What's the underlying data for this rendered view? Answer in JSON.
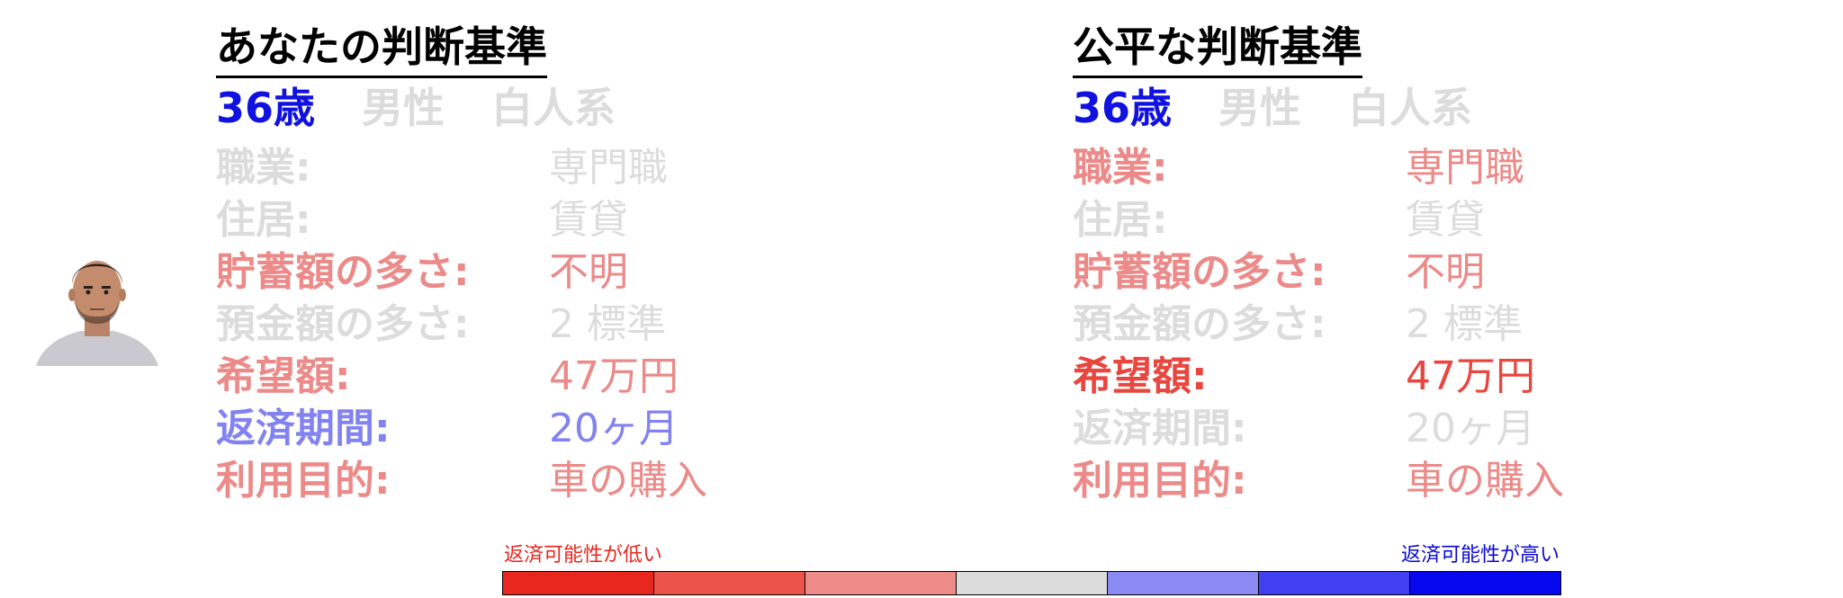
{
  "colors": {
    "gray": "#dcdcdc",
    "pink": "#eb8a88",
    "red": "#e8463f",
    "blue": "#1111e0",
    "periwinkle": "#8282f0"
  },
  "panels": [
    {
      "title": "あなたの判断基準",
      "demographics": [
        {
          "text": "36歳",
          "color": "#1111e0"
        },
        {
          "text": "男性",
          "color": "#dcdcdc"
        },
        {
          "text": "白人系",
          "color": "#dcdcdc"
        }
      ],
      "rows": [
        {
          "label": "職業:",
          "value": "専門職",
          "color": "#dcdcdc"
        },
        {
          "label": "住居:",
          "value": "賃貸",
          "color": "#dcdcdc"
        },
        {
          "label": "貯蓄額の多さ:",
          "value": "不明",
          "color": "#eb8a88"
        },
        {
          "label": "預金額の多さ:",
          "value": "2 標準",
          "color": "#dcdcdc"
        },
        {
          "label": "希望額:",
          "value": "47万円",
          "color": "#eb8a88"
        },
        {
          "label": "返済期間:",
          "value": "20ヶ月",
          "color": "#8282f0"
        },
        {
          "label": "利用目的:",
          "value": "車の購入",
          "color": "#eb8a88"
        }
      ]
    },
    {
      "title": "公平な判断基準",
      "demographics": [
        {
          "text": "36歳",
          "color": "#1111e0"
        },
        {
          "text": "男性",
          "color": "#dcdcdc"
        },
        {
          "text": "白人系",
          "color": "#dcdcdc"
        }
      ],
      "rows": [
        {
          "label": "職業:",
          "value": "専門職",
          "color": "#eb8a88"
        },
        {
          "label": "住居:",
          "value": "賃貸",
          "color": "#dcdcdc"
        },
        {
          "label": "貯蓄額の多さ:",
          "value": "不明",
          "color": "#eb8a88"
        },
        {
          "label": "預金額の多さ:",
          "value": "2 標準",
          "color": "#dcdcdc"
        },
        {
          "label": "希望額:",
          "value": "47万円",
          "color": "#e8463f"
        },
        {
          "label": "返済期間:",
          "value": "20ヶ月",
          "color": "#dcdcdc"
        },
        {
          "label": "利用目的:",
          "value": "車の購入",
          "color": "#eb8a88"
        }
      ]
    }
  ],
  "legend": {
    "low_label": "返済可能性が低い",
    "high_label": "返済可能性が高い",
    "scale_colors": [
      "#e8271e",
      "#ec534b",
      "#ed8b88",
      "#dcdcdc",
      "#8a8af2",
      "#4040f2",
      "#0808ef"
    ]
  }
}
